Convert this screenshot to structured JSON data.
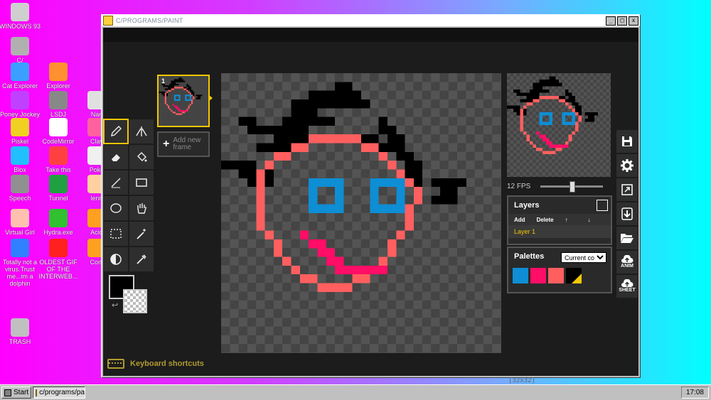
{
  "desktop": {
    "icons": [
      {
        "label": "WINDOWS 93",
        "icon": "computer-icon",
        "color": "#cfcfcf"
      },
      {
        "label": "C/",
        "icon": "drive-icon",
        "color": "#b0b0b0"
      },
      {
        "label": "Cat Explorer",
        "icon": "cat-globe-icon",
        "color": "#3aa0ff"
      },
      {
        "label": "Explorer",
        "icon": "explorer-icon",
        "color": "#ff9030"
      },
      {
        "label": "Poney Jockey",
        "icon": "pony-icon",
        "color": "#c040ff"
      },
      {
        "label": "LSDJ",
        "icon": "gameboy-icon",
        "color": "#888888"
      },
      {
        "label": "Nan",
        "icon": "nan-icon",
        "color": "#e0e0e0"
      },
      {
        "label": "Piskel",
        "icon": "palette-icon",
        "color": "#f0d020"
      },
      {
        "label": "CodeMirror",
        "icon": "codemirror-icon",
        "color": "#ffffff"
      },
      {
        "label": "Clav",
        "icon": "clav-icon",
        "color": "#ff60a0"
      },
      {
        "label": "Blox",
        "icon": "blox-icon",
        "color": "#20c0ff"
      },
      {
        "label": "Take this",
        "icon": "take-this-icon",
        "color": "#ff4040"
      },
      {
        "label": "Poke",
        "icon": "poke-icon",
        "color": "#f0f0f0"
      },
      {
        "label": "Speech",
        "icon": "speech-icon",
        "color": "#909090"
      },
      {
        "label": "Tunnel",
        "icon": "tunnel-icon",
        "color": "#20a040"
      },
      {
        "label": "lenn",
        "icon": "lenn-icon",
        "color": "#ffd0a0"
      },
      {
        "label": "Virtual Girl",
        "icon": "virtual-girl-icon",
        "color": "#ffc0b0"
      },
      {
        "label": "Hydra.exe",
        "icon": "hydra-icon",
        "color": "#30c030"
      },
      {
        "label": "Acid",
        "icon": "acid-icon",
        "color": "#ffa020"
      },
      {
        "label": "Totally not a virus.Trust me...im a dolphin",
        "icon": "dolphin-icon",
        "color": "#3080ff"
      },
      {
        "label": "OLDEST GIF OF THE INTERWEB...",
        "icon": "gif-icon",
        "color": "#ff2020"
      },
      {
        "label": "Cont",
        "icon": "cont-icon",
        "color": "#ffa020"
      },
      {
        "label": "TRASH",
        "icon": "trash-icon",
        "color": "#c0c0c0"
      }
    ]
  },
  "window": {
    "title": "C/PROGRAMS/PAINT",
    "controls": {
      "minimize": "_",
      "maximize": "□",
      "close": "x"
    }
  },
  "tools": {
    "pen": "pen-icon",
    "vertical-mirror": "mirror-pen-icon",
    "eraser": "eraser-icon",
    "bucket": "paint-bucket-icon",
    "stroke": "line-icon",
    "rectangle": "rectangle-icon",
    "circle": "circle-icon",
    "move": "hand-icon",
    "rect-select": "rect-select-icon",
    "magic-wand": "magic-wand-icon",
    "lighten": "lighten-icon",
    "color-picker": "eyedropper-icon",
    "primary_color": "#000000",
    "secondary_color": "transparent"
  },
  "frames": {
    "items": [
      {
        "number": "1"
      }
    ],
    "add_label": "Add new frame"
  },
  "canvas": {
    "size_label": "[32x32]"
  },
  "keyboard": {
    "label": "Keyboard shortcuts"
  },
  "preview": {
    "fps_label": "12 FPS",
    "fps_fraction": 0.5
  },
  "layers": {
    "title": "Layers",
    "add": "Add",
    "delete": "Delete",
    "up": "↑",
    "down": "↓",
    "items": [
      "Layer 1"
    ]
  },
  "palettes": {
    "title": "Palettes",
    "selected": "Current col",
    "swatches": [
      "#0e8ed4",
      "#ff0d66",
      "#ff5f5f",
      "#000000"
    ]
  },
  "side_toolbar": {
    "save": "save-icon",
    "settings": "gear-icon",
    "resize": "resize-icon",
    "export": "export-icon",
    "open": "folder-icon",
    "anim_label": "ANIM",
    "sheet_label": "SHEET"
  },
  "taskbar": {
    "start": "Start",
    "task": "c/programs/pai",
    "clock": "17:08"
  }
}
